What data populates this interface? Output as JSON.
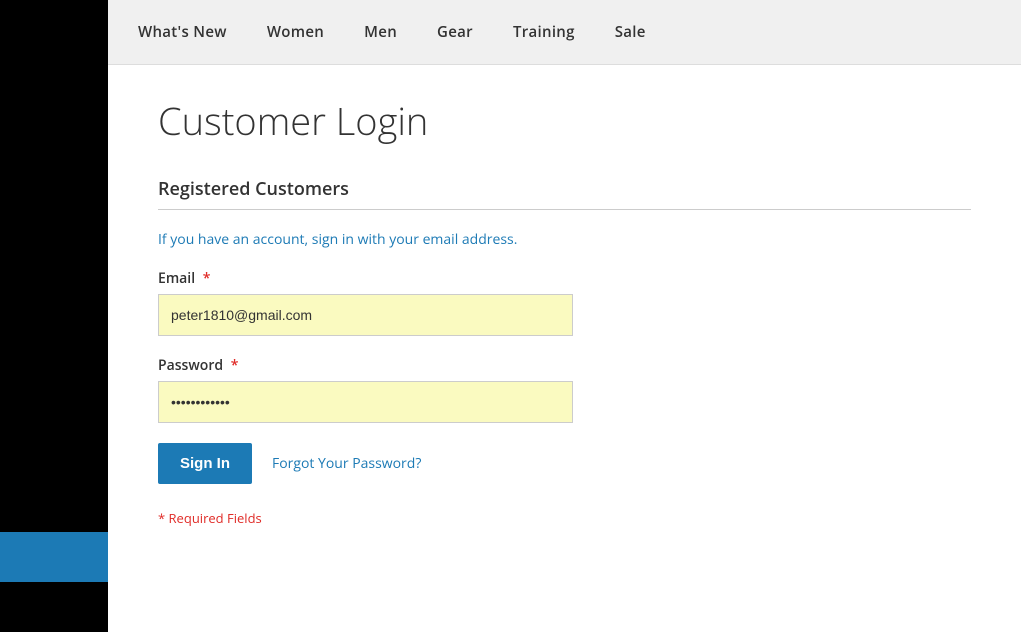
{
  "navbar": {
    "items": [
      {
        "label": "What's New",
        "id": "whats-new"
      },
      {
        "label": "Women",
        "id": "women"
      },
      {
        "label": "Men",
        "id": "men"
      },
      {
        "label": "Gear",
        "id": "gear"
      },
      {
        "label": "Training",
        "id": "training"
      },
      {
        "label": "Sale",
        "id": "sale"
      }
    ]
  },
  "page": {
    "title": "Customer Login"
  },
  "registered_section": {
    "title": "Registered Customers",
    "info_text": "If you have an account, sign in with your email address."
  },
  "form": {
    "email_label": "Email",
    "email_value": "peter1810@gmail.com",
    "email_placeholder": "",
    "password_label": "Password",
    "password_value": "••••••••••",
    "sign_in_label": "Sign In",
    "forgot_password_label": "Forgot Your Password?",
    "required_note": "* Required Fields"
  }
}
